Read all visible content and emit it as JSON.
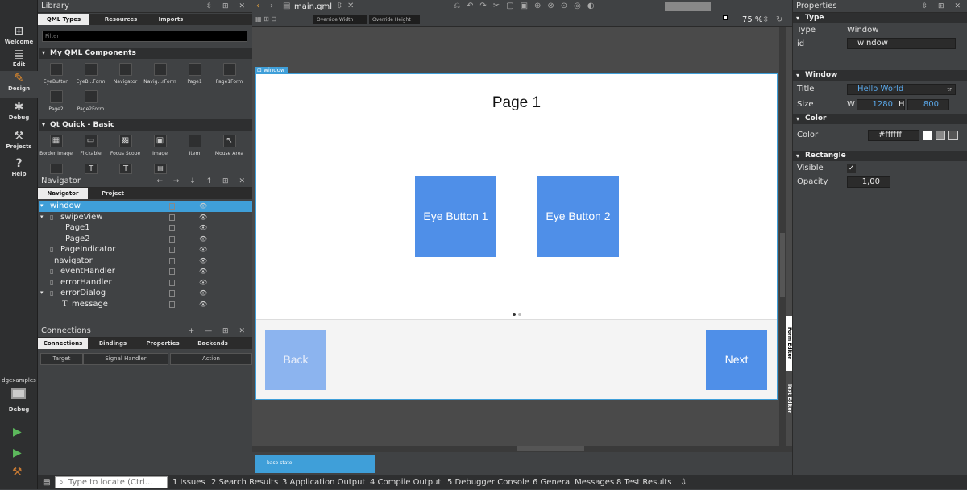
{
  "modes": [
    {
      "label": "Welcome",
      "icon": "grid-icon",
      "glyph": "⊞"
    },
    {
      "label": "Edit",
      "icon": "edit-icon",
      "glyph": "▤"
    },
    {
      "label": "Design",
      "icon": "pencil-icon",
      "glyph": "✎"
    },
    {
      "label": "Debug",
      "icon": "bug-icon",
      "glyph": "✱"
    },
    {
      "label": "Projects",
      "icon": "wrench-icon",
      "glyph": "🔧"
    },
    {
      "label": "Help",
      "icon": "help-icon",
      "glyph": "?"
    }
  ],
  "kit": {
    "name": "dgexamples",
    "mode": "Debug"
  },
  "library": {
    "title": "Library",
    "tabs": [
      "QML Types",
      "Resources",
      "Imports"
    ],
    "filter_placeholder": "Filter",
    "sections": [
      {
        "title": "My QML Components",
        "items": [
          "EyeButton",
          "EyeB...Form",
          "Navigator",
          "Navig...rForm",
          "Page1",
          "Page1Form",
          "Page2",
          "Page2Form"
        ]
      },
      {
        "title": "Qt Quick - Basic",
        "items": [
          "Border Image",
          "Flickable",
          "Focus Scope",
          "Image",
          "Item",
          "Mouse Area"
        ]
      }
    ]
  },
  "navigator": {
    "title": "Navigator",
    "tabs": [
      "Navigator",
      "Project"
    ],
    "rows": [
      "window",
      "swipeView",
      "Page1",
      "Page2",
      "PageIndicator",
      "navigator",
      "eventHandler",
      "errorHandler",
      "errorDialog",
      "message"
    ]
  },
  "connections": {
    "title": "Connections",
    "tabs": [
      "Connections",
      "Bindings",
      "Properties",
      "Backends"
    ],
    "columns": [
      "Target",
      "Signal Handler",
      "Action"
    ]
  },
  "editor": {
    "file": "main.qml",
    "override_width": "Override Width",
    "override_height": "Override Height",
    "zoom": "75 %",
    "window_tag": "window",
    "page_title": "Page 1",
    "button1": "Eye Button 1",
    "button2": "Eye Button 2",
    "back": "Back",
    "next": "Next",
    "state": "base state",
    "side_tab1": "Form Editor",
    "side_tab2": "Text Editor"
  },
  "properties": {
    "title": "Properties",
    "sections": {
      "type": "Type",
      "window": "Window",
      "color": "Color",
      "rectangle": "Rectangle"
    },
    "type_label": "Type",
    "type_value": "Window",
    "id_label": "id",
    "id_value": "window",
    "title_label": "Title",
    "title_value": "Hello World",
    "size_label": "Size",
    "w_label": "W",
    "w_value": "1280",
    "h_label": "H",
    "h_value": "800",
    "color_label": "Color",
    "color_value": "#ffffff",
    "visible_label": "Visible",
    "visible_check": "✓",
    "opacity_label": "Opacity",
    "opacity_value": "1,00",
    "tr": "tr"
  },
  "status": {
    "locate_placeholder": "Type to locate (Ctrl...",
    "items": [
      "1  Issues",
      "2  Search Results",
      "3  Application Output",
      "4  Compile Output",
      "5  Debugger Console",
      "6  General Messages",
      "8  Test Results"
    ]
  },
  "colors": {
    "accent": "#3f9fd9",
    "button": "#4f8fe8",
    "back_disabled": "#8cb4ef"
  }
}
